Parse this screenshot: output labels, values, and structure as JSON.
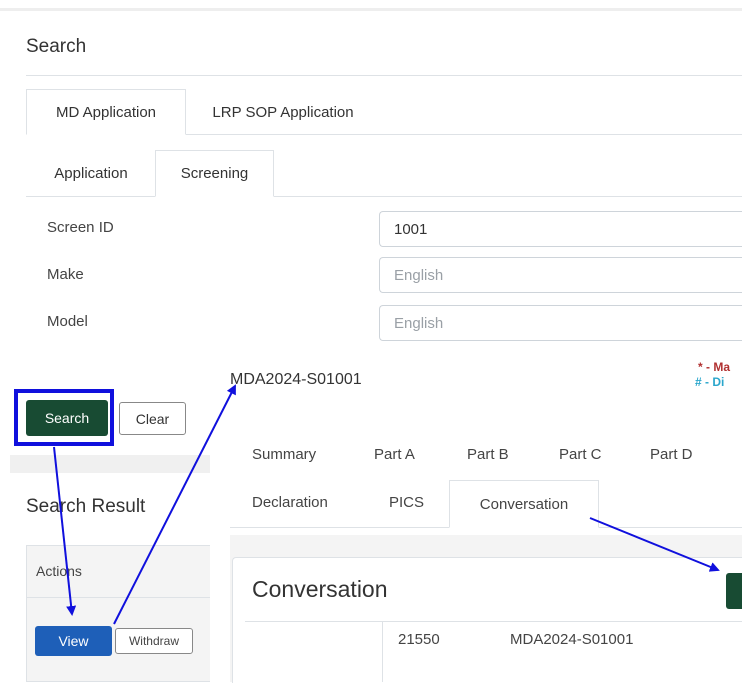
{
  "search_panel": {
    "title": "Search",
    "tabs": [
      {
        "label": "MD Application",
        "active": true
      },
      {
        "label": "LRP SOP Application",
        "active": false
      }
    ],
    "subtabs": [
      {
        "label": "Application",
        "active": false
      },
      {
        "label": "Screening",
        "active": true
      }
    ],
    "fields": [
      {
        "label": "Screen ID",
        "value": "1001",
        "placeholder": ""
      },
      {
        "label": "Make",
        "value": "",
        "placeholder": "English"
      },
      {
        "label": "Model",
        "value": "",
        "placeholder": "English"
      }
    ],
    "search_button": "Search",
    "clear_button": "Clear"
  },
  "result_panel": {
    "title": "Search Result",
    "actions_header": "Actions",
    "view_button": "View",
    "withdraw_button": "Withdraw"
  },
  "detail_view": {
    "record_id": "MDA2024-S01001",
    "legend": {
      "mandatory": "* - Ma",
      "display": "# - Di"
    },
    "tabs_row1": [
      "Summary",
      "Part A",
      "Part B",
      "Part C",
      "Part D"
    ],
    "tabs_row2": [
      "Declaration",
      "PICS",
      "Conversation"
    ],
    "active_tab": "Conversation",
    "section_title": "Conversation",
    "row": {
      "number": "21550",
      "reference": "MDA2024-S01001"
    }
  },
  "annotation": {
    "highlight_color": "#1010dd",
    "arrow_color": "#1010dd"
  }
}
